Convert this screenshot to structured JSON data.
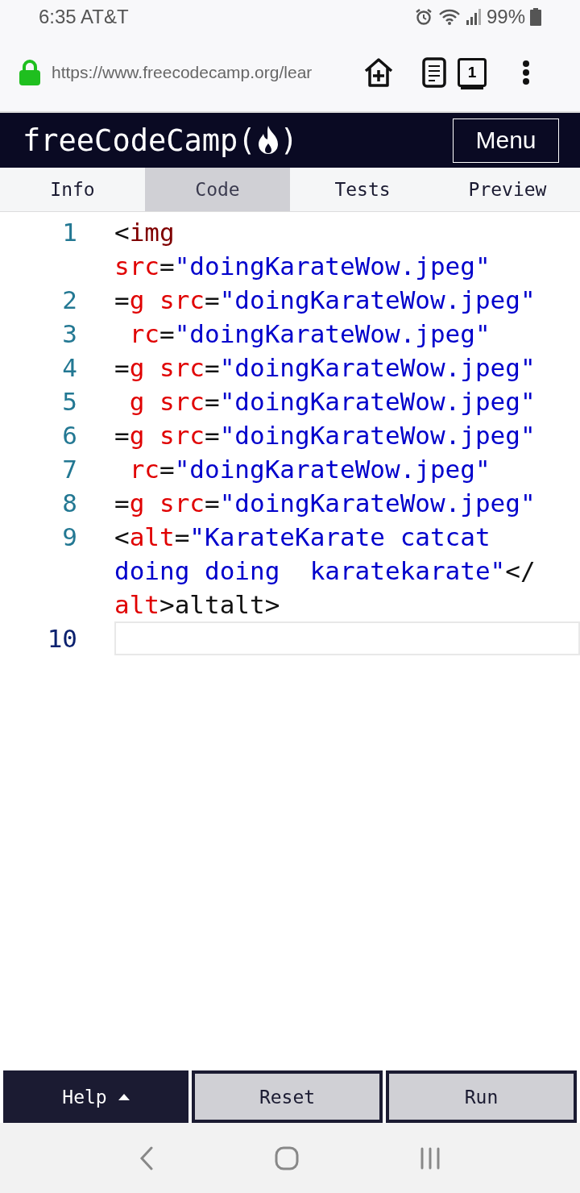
{
  "status_bar": {
    "time_carrier": "6:35 AT&T",
    "battery": "99%"
  },
  "browser": {
    "url": "https://www.freecodecamp.org/lear",
    "tab_count": "1"
  },
  "header": {
    "logo_left": "freeCodeCamp(",
    "logo_right": ")",
    "menu": "Menu"
  },
  "tabs": [
    {
      "label": "Info",
      "selected": false
    },
    {
      "label": "Code",
      "selected": true
    },
    {
      "label": "Tests",
      "selected": false
    },
    {
      "label": "Preview",
      "selected": false
    }
  ],
  "editor": {
    "lines": [
      {
        "number": "1",
        "active": false,
        "rows": [
          [
            {
              "kind": "punct",
              "text": "<"
            },
            {
              "kind": "tag",
              "text": "img"
            }
          ],
          [
            {
              "kind": "attr",
              "text": "src"
            },
            {
              "kind": "punct",
              "text": "="
            },
            {
              "kind": "string",
              "text": "\"doingKarateWow.jpeg\""
            }
          ]
        ]
      },
      {
        "number": "2",
        "active": false,
        "tokens": [
          {
            "kind": "punct",
            "text": "="
          },
          {
            "kind": "attr",
            "text": "g src"
          },
          {
            "kind": "punct",
            "text": "="
          },
          {
            "kind": "string",
            "text": "\"doingKarateWow.jpeg\""
          }
        ]
      },
      {
        "number": "3",
        "active": false,
        "tokens": [
          {
            "kind": "attr",
            "text": " rc"
          },
          {
            "kind": "punct",
            "text": "="
          },
          {
            "kind": "string",
            "text": "\"doingKarateWow.jpeg\""
          }
        ]
      },
      {
        "number": "4",
        "active": false,
        "tokens": [
          {
            "kind": "punct",
            "text": "="
          },
          {
            "kind": "attr",
            "text": "g src"
          },
          {
            "kind": "punct",
            "text": "="
          },
          {
            "kind": "string",
            "text": "\"doingKarateWow.jpeg\""
          }
        ]
      },
      {
        "number": "5",
        "active": false,
        "tokens": [
          {
            "kind": "attr",
            "text": " g src"
          },
          {
            "kind": "punct",
            "text": "="
          },
          {
            "kind": "string",
            "text": "\"doingKarateWow.jpeg\""
          }
        ]
      },
      {
        "number": "6",
        "active": false,
        "tokens": [
          {
            "kind": "punct",
            "text": "="
          },
          {
            "kind": "attr",
            "text": "g src"
          },
          {
            "kind": "punct",
            "text": "="
          },
          {
            "kind": "string",
            "text": "\"doingKarateWow.jpeg\""
          }
        ]
      },
      {
        "number": "7",
        "active": false,
        "tokens": [
          {
            "kind": "attr",
            "text": " rc"
          },
          {
            "kind": "punct",
            "text": "="
          },
          {
            "kind": "string",
            "text": "\"doingKarateWow.jpeg\""
          }
        ]
      },
      {
        "number": "8",
        "active": false,
        "tokens": [
          {
            "kind": "punct",
            "text": "="
          },
          {
            "kind": "attr",
            "text": "g src"
          },
          {
            "kind": "punct",
            "text": "="
          },
          {
            "kind": "string",
            "text": "\"doingKarateWow.jpeg\""
          }
        ]
      },
      {
        "number": "9",
        "active": false,
        "rows": [
          [
            {
              "kind": "punct",
              "text": "<"
            },
            {
              "kind": "attr",
              "text": "alt"
            },
            {
              "kind": "punct",
              "text": "="
            },
            {
              "kind": "string",
              "text": "\"KarateKarate catcat"
            }
          ],
          [
            {
              "kind": "string",
              "text": "doing doing  karatekarate\""
            },
            {
              "kind": "punct",
              "text": "</"
            }
          ],
          [
            {
              "kind": "attr",
              "text": "alt"
            },
            {
              "kind": "punct",
              "text": ">altalt>"
            }
          ]
        ]
      },
      {
        "number": "10",
        "active": true
      }
    ]
  },
  "actions": {
    "help": "Help",
    "reset": "Reset",
    "run": "Run"
  }
}
